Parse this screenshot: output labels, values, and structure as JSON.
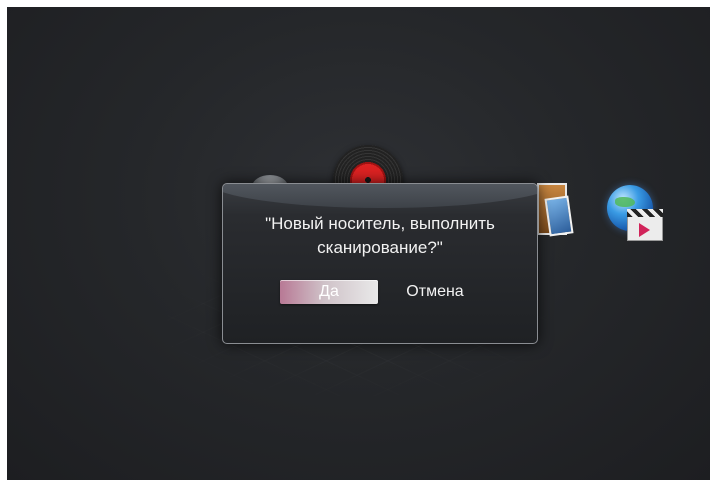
{
  "menu": {
    "icons": [
      "camera-icon",
      "vinyl-record-icon",
      "film-icon",
      "photos-icon",
      "internet-video-icon"
    ]
  },
  "dialog": {
    "message_line1": "\"Новый носитель, выполнить",
    "message_line2": "сканирование?\"",
    "yes_label": "Да",
    "cancel_label": "Отмена",
    "selected": "yes"
  },
  "colors": {
    "background": "#25272a",
    "selected_button_accent": "#b87995",
    "text": "#f2f2f2"
  }
}
